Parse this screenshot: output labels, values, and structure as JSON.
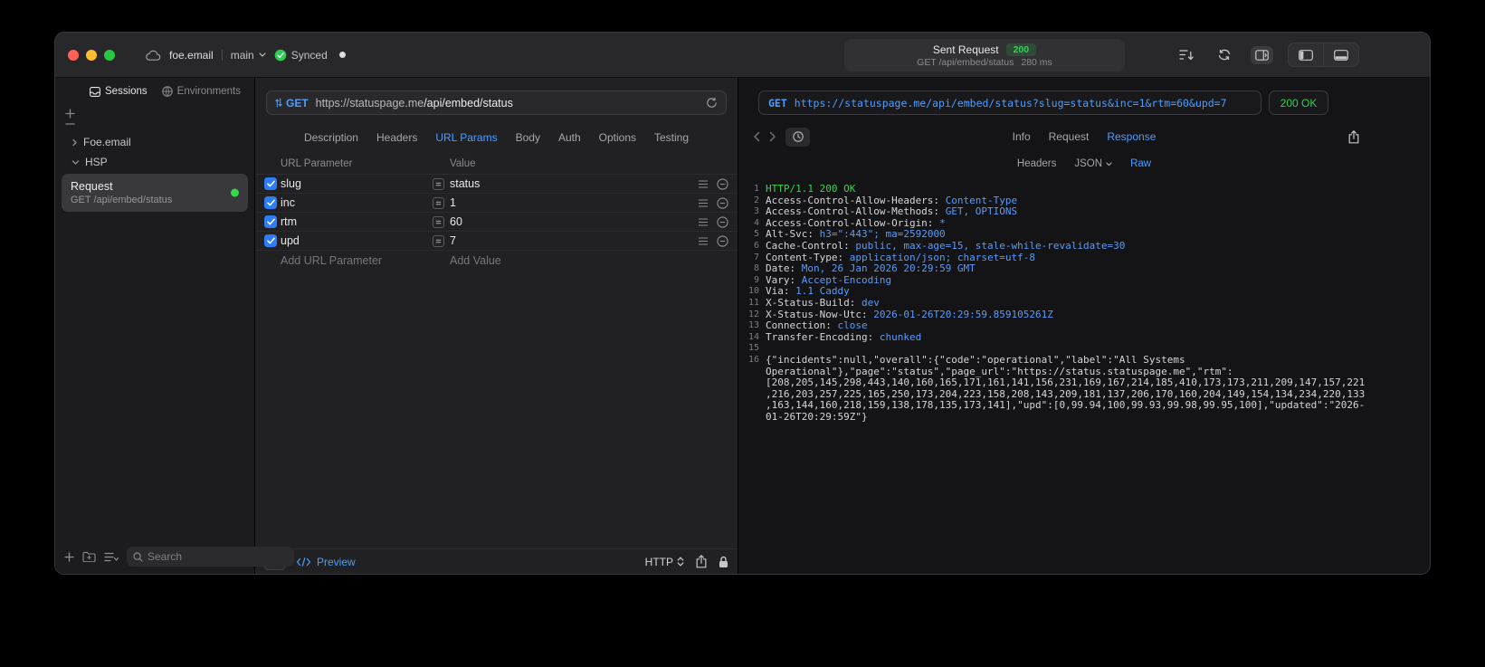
{
  "colors": {
    "accent_blue": "#4D9DFF",
    "value_blue": "#5B9BF8",
    "success_green": "#30D158",
    "checkbox_blue": "#2D7CF8"
  },
  "titlebar": {
    "project": "foe.email",
    "branch": "main",
    "sync_label": "Synced",
    "summary": {
      "title": "Sent Request",
      "status_code": "200",
      "subtitle": "GET /api/embed/status",
      "duration": "280 ms"
    }
  },
  "sidebar": {
    "tabs": [
      {
        "label": "Sessions",
        "icon": "sessions-icon",
        "active": true
      },
      {
        "label": "Environments",
        "icon": "environments-icon",
        "active": false
      }
    ],
    "groups": [
      {
        "label": "Foe.email",
        "expanded": false
      },
      {
        "label": "HSP",
        "expanded": true
      }
    ],
    "request_item": {
      "title": "Request",
      "subtitle": "GET /api/embed/status",
      "selected": true
    },
    "search_placeholder": "Search"
  },
  "editor": {
    "method": "GET",
    "url_host": "https://statuspage.me",
    "url_path": "/api/embed/status",
    "tabs": [
      {
        "label": "Description"
      },
      {
        "label": "Headers"
      },
      {
        "label": "URL Params",
        "active": true
      },
      {
        "label": "Body"
      },
      {
        "label": "Auth"
      },
      {
        "label": "Options"
      },
      {
        "label": "Testing"
      }
    ],
    "param_table": {
      "name_header": "URL Parameter",
      "value_header": "Value",
      "rows": [
        {
          "name": "slug",
          "value": "status",
          "checked": true
        },
        {
          "name": "inc",
          "value": "1",
          "checked": true
        },
        {
          "name": "rtm",
          "value": "60",
          "checked": true
        },
        {
          "name": "upd",
          "value": "7",
          "checked": true
        }
      ],
      "add_name_placeholder": "Add URL Parameter",
      "add_value_placeholder": "Add Value"
    },
    "footer": {
      "preview_label": "Preview",
      "protocol_label": "HTTP"
    }
  },
  "response": {
    "method": "GET",
    "url": "https://statuspage.me/api/embed/status?slug=status&inc=1&rtm=60&upd=7",
    "status": "200 OK",
    "tabs": [
      {
        "label": "Info"
      },
      {
        "label": "Request"
      },
      {
        "label": "Response",
        "active": true
      }
    ],
    "subtabs": [
      {
        "label": "Headers"
      },
      {
        "label": "JSON",
        "chevron": true
      },
      {
        "label": "Raw",
        "active": true
      }
    ],
    "lines": [
      {
        "n": "1",
        "segments": [
          {
            "text": "HTTP/1.1 200 OK",
            "color": "status"
          }
        ]
      },
      {
        "n": "2",
        "segments": [
          {
            "text": "Access-Control-Allow-Headers: ",
            "color": "key"
          },
          {
            "text": "Content-Type",
            "color": "value"
          }
        ]
      },
      {
        "n": "3",
        "segments": [
          {
            "text": "Access-Control-Allow-Methods: ",
            "color": "key"
          },
          {
            "text": "GET, OPTIONS",
            "color": "value"
          }
        ]
      },
      {
        "n": "4",
        "segments": [
          {
            "text": "Access-Control-Allow-Origin: ",
            "color": "key"
          },
          {
            "text": "*",
            "color": "value"
          }
        ]
      },
      {
        "n": "5",
        "segments": [
          {
            "text": "Alt-Svc: ",
            "color": "key"
          },
          {
            "text": "h3=\":443\"; ma=2592000",
            "color": "value"
          }
        ]
      },
      {
        "n": "6",
        "segments": [
          {
            "text": "Cache-Control: ",
            "color": "key"
          },
          {
            "text": "public, max-age=15, stale-while-revalidate=30",
            "color": "value"
          }
        ]
      },
      {
        "n": "7",
        "segments": [
          {
            "text": "Content-Type: ",
            "color": "key"
          },
          {
            "text": "application/json; charset=utf-8",
            "color": "value"
          }
        ]
      },
      {
        "n": "8",
        "segments": [
          {
            "text": "Date: ",
            "color": "key"
          },
          {
            "text": "Mon, 26 Jan 2026 20:29:59 GMT",
            "color": "value"
          }
        ]
      },
      {
        "n": "9",
        "segments": [
          {
            "text": "Vary: ",
            "color": "key"
          },
          {
            "text": "Accept-Encoding",
            "color": "value"
          }
        ]
      },
      {
        "n": "10",
        "segments": [
          {
            "text": "Via: ",
            "color": "key"
          },
          {
            "text": "1.1 Caddy",
            "color": "value"
          }
        ]
      },
      {
        "n": "11",
        "segments": [
          {
            "text": "X-Status-Build: ",
            "color": "key"
          },
          {
            "text": "dev",
            "color": "value"
          }
        ]
      },
      {
        "n": "12",
        "segments": [
          {
            "text": "X-Status-Now-Utc: ",
            "color": "key"
          },
          {
            "text": "2026-01-26T20:29:59.859105261Z",
            "color": "value"
          }
        ]
      },
      {
        "n": "13",
        "segments": [
          {
            "text": "Connection: ",
            "color": "key"
          },
          {
            "text": "close",
            "color": "value"
          }
        ]
      },
      {
        "n": "14",
        "segments": [
          {
            "text": "Transfer-Encoding: ",
            "color": "key"
          },
          {
            "text": "chunked",
            "color": "value"
          }
        ]
      },
      {
        "n": "15",
        "segments": []
      },
      {
        "n": "16",
        "segments": [
          {
            "text": "{\"incidents\":null,\"overall\":{\"code\":\"operational\",\"label\":\"All Systems Operational\"},\"page\":\"status\",\"page_url\":\"https://status.statuspage.me\",\"rtm\":[208,205,145,298,443,140,160,165,171,161,141,156,231,169,167,214,185,410,173,173,211,209,147,157,221,216,203,257,225,165,250,173,204,223,158,208,143,209,181,137,206,170,160,204,149,154,134,234,220,133,163,144,160,218,159,138,178,135,173,141],\"upd\":[0,99.94,100,99.93,99.98,99.95,100],\"updated\":\"2026-01-26T20:29:59Z\"}",
            "color": "key"
          }
        ]
      }
    ]
  }
}
